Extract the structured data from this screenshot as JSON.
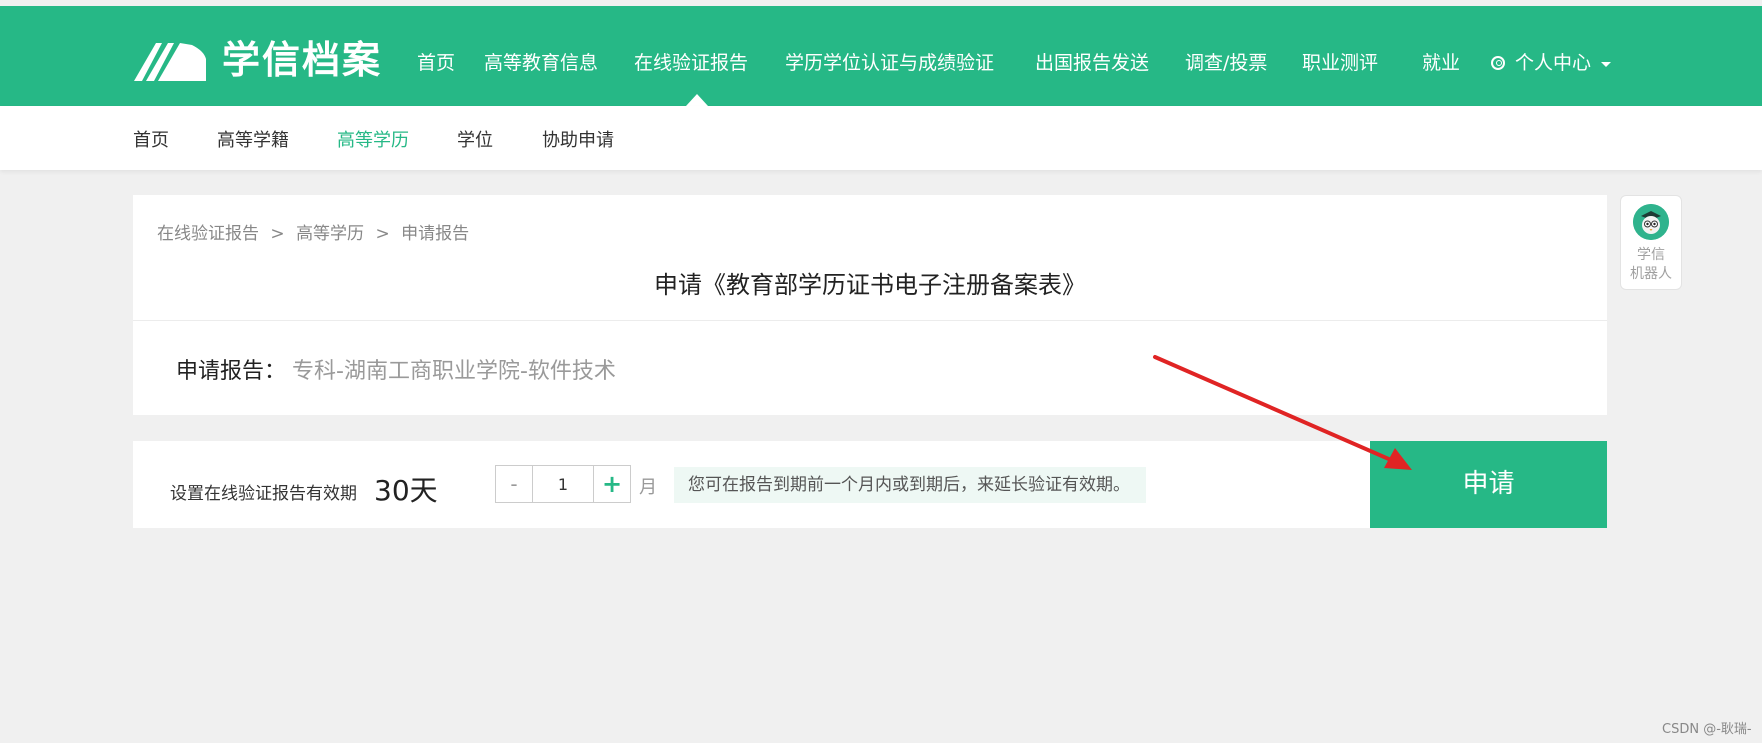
{
  "brand": {
    "logo_text": "学信档案"
  },
  "nav": {
    "items": [
      "首页",
      "高等教育信息",
      "在线验证报告",
      "学历学位认证与成绩验证",
      "出国报告发送",
      "调查/投票",
      "职业测评",
      "就业"
    ],
    "active": "在线验证报告",
    "user_menu": "个人中心"
  },
  "subnav": {
    "items": [
      "首页",
      "高等学籍",
      "高等学历",
      "学位",
      "协助申请"
    ],
    "active": "高等学历"
  },
  "breadcrumb": {
    "items": [
      "在线验证报告",
      "高等学历",
      "申请报告"
    ],
    "separator": ">"
  },
  "card": {
    "title": "申请《教育部学历证书电子注册备案表》",
    "report_label": "申请报告：",
    "report_value": "专科-湖南工商职业学院-软件技术"
  },
  "validity": {
    "label": "设置在线验证报告有效期",
    "days": "30天",
    "stepper": {
      "minus": "-",
      "value": "1",
      "plus": "+"
    },
    "unit": "月",
    "hint": "您可在报告到期前一个月内或到期后，来延长验证有效期。"
  },
  "apply_button": "申请",
  "robot": {
    "line1": "学信",
    "line2": "机器人"
  },
  "watermark": "CSDN @-耿瑞-",
  "colors": {
    "brand_green": "#26b886",
    "arrow_red": "#e02424",
    "background": "#f0f0f0"
  }
}
